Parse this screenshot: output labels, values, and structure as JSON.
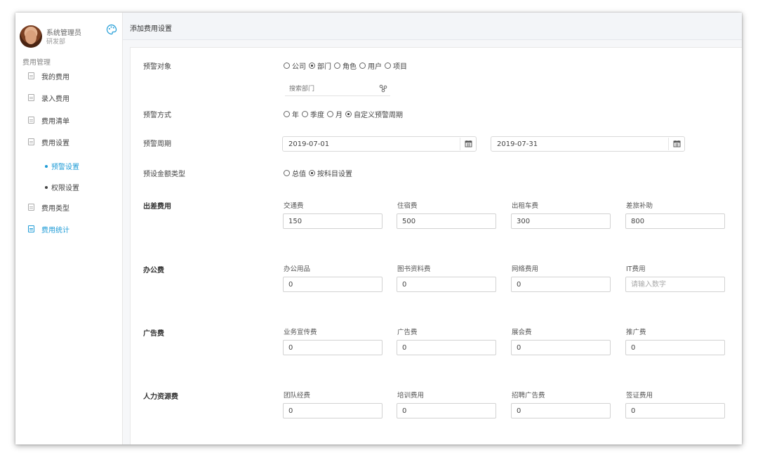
{
  "user": {
    "name": "系统管理员",
    "dept": "研发部"
  },
  "sidebar": {
    "section_title": "费用管理",
    "items": [
      {
        "label": "我的费用"
      },
      {
        "label": "录入费用"
      },
      {
        "label": "费用清单"
      },
      {
        "label": "费用设置"
      },
      {
        "label": "费用类型"
      },
      {
        "label": "费用统计"
      }
    ],
    "sub_items": [
      {
        "label": "预警设置"
      },
      {
        "label": "权限设置"
      }
    ]
  },
  "header": {
    "title": "添加费用设置"
  },
  "form": {
    "target": {
      "label": "预警对象",
      "options": [
        "公司",
        "部门",
        "角色",
        "用户",
        "项目"
      ],
      "selected": "部门",
      "search_placeholder": "搜索部门"
    },
    "mode": {
      "label": "预警方式",
      "options": [
        "年",
        "季度",
        "月",
        "自定义预警周期"
      ],
      "selected": "自定义预警周期"
    },
    "period": {
      "label": "预警周期",
      "start": "2019-07-01",
      "end": "2019-07-31"
    },
    "amount_type": {
      "label": "预设金额类型",
      "options": [
        "总值",
        "按科目设置"
      ],
      "selected": "按科目设置"
    },
    "groups": [
      {
        "title": "出差费用",
        "fields": [
          {
            "label": "交通费",
            "value": "150"
          },
          {
            "label": "住宿费",
            "value": "500"
          },
          {
            "label": "出租车费",
            "value": "300"
          },
          {
            "label": "差旅补助",
            "value": "800"
          }
        ]
      },
      {
        "title": "办公费",
        "fields": [
          {
            "label": "办公用品",
            "value": "0"
          },
          {
            "label": "图书资料费",
            "value": "0"
          },
          {
            "label": "网络费用",
            "value": "0"
          },
          {
            "label": "IT费用",
            "value": "",
            "placeholder": "请输入数字"
          }
        ]
      },
      {
        "title": "广告费",
        "fields": [
          {
            "label": "业务宣传费",
            "value": "0"
          },
          {
            "label": "广告费",
            "value": "0"
          },
          {
            "label": "展会费",
            "value": "0"
          },
          {
            "label": "推广费",
            "value": "0"
          }
        ]
      },
      {
        "title": "人力资源费",
        "fields": [
          {
            "label": "团队经费",
            "value": "0"
          },
          {
            "label": "培训费用",
            "value": "0"
          },
          {
            "label": "招聘广告费",
            "value": "0"
          },
          {
            "label": "签证费用",
            "value": "0"
          }
        ]
      }
    ]
  },
  "colors": {
    "accent": "#1e9bd6",
    "header_bg": "#f3f5f8"
  },
  "icons": {
    "palette": "palette-icon",
    "tree": "tree-icon",
    "calendar": "calendar-icon"
  }
}
